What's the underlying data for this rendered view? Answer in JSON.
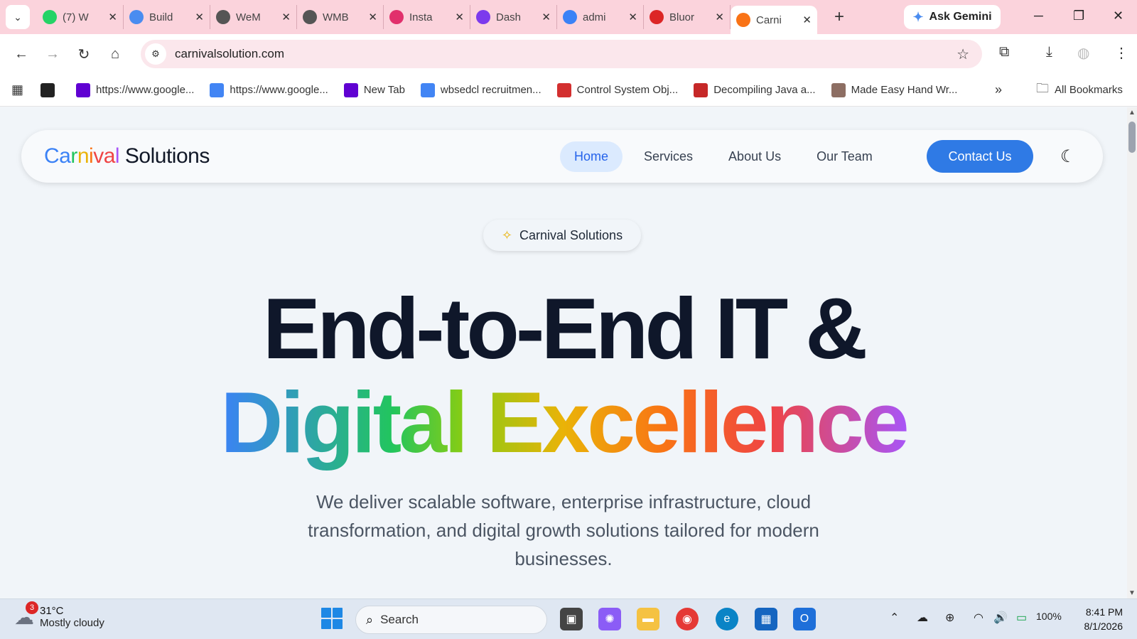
{
  "browser": {
    "tabs": [
      {
        "title": "(7) W",
        "icon": "whatsapp-icon",
        "color": "#25d366"
      },
      {
        "title": "Build",
        "icon": "gemini-icon",
        "color": "#4a8cf0"
      },
      {
        "title": "WeM",
        "icon": "globe-icon",
        "color": "#555555"
      },
      {
        "title": "WMB",
        "icon": "globe-icon",
        "color": "#555555"
      },
      {
        "title": "Insta",
        "icon": "instagram-icon",
        "color": "#e1306c"
      },
      {
        "title": "Dash",
        "icon": "dashboard-icon",
        "color": "#7c3aed"
      },
      {
        "title": "admi",
        "icon": "admin-icon",
        "color": "#3b82f6"
      },
      {
        "title": "Bluor",
        "icon": "bluor-icon",
        "color": "#dc2626"
      },
      {
        "title": "Carni",
        "icon": "cs-icon",
        "color": "#f97316",
        "active": true
      }
    ],
    "ask_gemini": "Ask Gemini",
    "url": "carnivalsolution.com",
    "bookmarks": [
      {
        "label": "",
        "icon": "globe-icon",
        "color": "#222222"
      },
      {
        "label": "https://www.google...",
        "icon": "yahoo-icon",
        "color": "#6001d2"
      },
      {
        "label": "https://www.google...",
        "icon": "google-icon",
        "color": "#4285f4"
      },
      {
        "label": "New Tab",
        "icon": "yahoo-icon",
        "color": "#6001d2"
      },
      {
        "label": "wbsedcl recruitmen...",
        "icon": "google-icon",
        "color": "#4285f4"
      },
      {
        "label": "Control System Obj...",
        "icon": "pdf-icon",
        "color": "#d32f2f"
      },
      {
        "label": "Decompiling Java a...",
        "icon": "wifi-icon",
        "color": "#c62828"
      },
      {
        "label": "Made Easy Hand Wr...",
        "icon": "pen-icon",
        "color": "#8d6e63"
      }
    ],
    "all_bookmarks": "All Bookmarks"
  },
  "site": {
    "logo": {
      "part1": "Carnival",
      "part2": "Solutions"
    },
    "nav": [
      "Home",
      "Services",
      "About Us",
      "Our Team"
    ],
    "contact": "Contact Us",
    "pill": "Carnival Solutions",
    "headline_line1": "End-to-End IT &",
    "headline_line2": "Digital Excellence",
    "lead": "We deliver scalable software, enterprise infrastructure, cloud transformation, and digital growth solutions tailored for modern businesses."
  },
  "taskbar": {
    "weather_badge": "3",
    "temp": "31°C",
    "weather": "Mostly cloudy",
    "search": "Search",
    "battery": "100%",
    "time": "8:41 PM",
    "date": "8/1/2026"
  }
}
